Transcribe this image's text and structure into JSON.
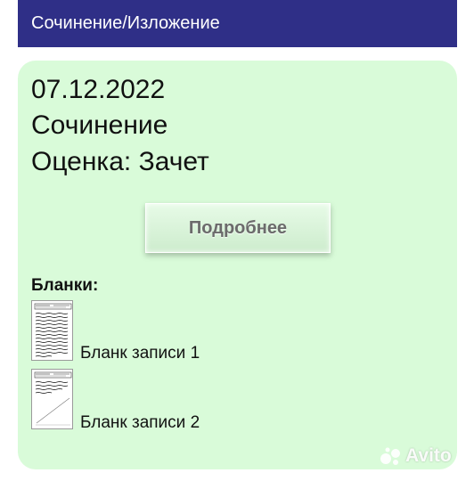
{
  "header": {
    "title": "Сочинение/Изложение"
  },
  "card": {
    "date": "07.12.2022",
    "type": "Сочинение",
    "grade": "Оценка: Зачет",
    "details_button": "Подробнее",
    "blanks_title": "Бланки:",
    "blanks": [
      {
        "label": "Бланк записи 1"
      },
      {
        "label": "Бланк записи 2"
      }
    ]
  },
  "watermark": {
    "text": "Avito"
  },
  "colors": {
    "header_bg": "#2f2f87",
    "card_bg": "#d9fbd9"
  }
}
